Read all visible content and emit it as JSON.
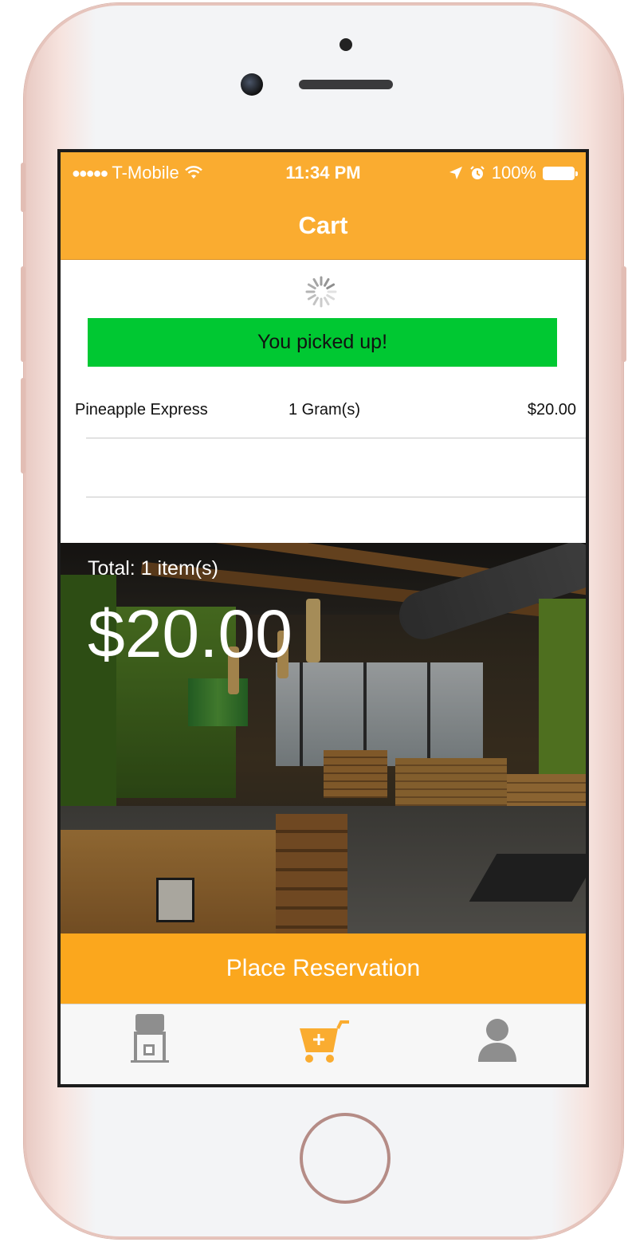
{
  "status_bar": {
    "signal_dots": "●●●●●",
    "carrier": "T-Mobile",
    "time": "11:34 PM",
    "battery": "100%",
    "icons": [
      "wifi-icon",
      "location-icon",
      "alarm-icon",
      "battery-icon"
    ]
  },
  "nav": {
    "title": "Cart"
  },
  "loading_indicator": "spinner-icon",
  "banner": {
    "text": "You picked up!",
    "color": "#00c832"
  },
  "cart": {
    "items": [
      {
        "name": "Pineapple Express",
        "quantity": "1 Gram(s)",
        "price": "$20.00"
      }
    ]
  },
  "summary": {
    "total_label": "Total: 1 item(s)",
    "total_amount": "$20.00"
  },
  "actions": {
    "place_reservation": "Place Reservation"
  },
  "tab_bar": {
    "tabs": [
      {
        "icon": "store-icon",
        "active": false
      },
      {
        "icon": "cart-icon",
        "active": true
      },
      {
        "icon": "profile-icon",
        "active": false
      }
    ]
  },
  "colors": {
    "accent": "#faac30",
    "button": "#fba71d",
    "success": "#00c832",
    "inactive_tab": "#8e8e8e"
  }
}
